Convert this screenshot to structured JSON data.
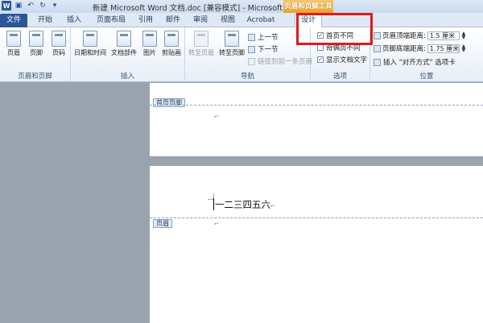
{
  "title_bar": {
    "document_title": "新建 Microsoft Word 文档.doc [兼容模式] - Microsoft Word",
    "context_tools": "页眉和页脚工具"
  },
  "tabs": {
    "file": "文件",
    "home": "开始",
    "insert": "插入",
    "layout": "页面布局",
    "references": "引用",
    "mailings": "邮件",
    "review": "审阅",
    "view": "视图",
    "acrobat": "Acrobat",
    "design": "设计"
  },
  "ribbon": {
    "group_header_footer": {
      "label": "页眉和页脚",
      "header": "页眉",
      "footer": "页脚",
      "page_number": "页码"
    },
    "group_insert": {
      "label": "插入",
      "date_time": "日期和时间",
      "doc_parts": "文档部件",
      "picture": "图片",
      "clip_art": "剪贴画"
    },
    "group_navigation": {
      "label": "导航",
      "goto_header": "转至页眉",
      "goto_footer": "转至页脚",
      "previous": "上一节",
      "next": "下一节",
      "link_previous": "链接到前一条页眉"
    },
    "group_options": {
      "label": "选项",
      "different_first_page": "首页不同",
      "different_odd_even": "奇偶页不同",
      "show_document_text": "显示文档文字",
      "different_first_page_checked": true,
      "different_odd_even_checked": false,
      "show_document_text_checked": true
    },
    "group_position": {
      "label": "位置",
      "header_from_top_label": "页眉顶端距离:",
      "header_from_top_value": "1.5 厘米",
      "footer_from_bottom_label": "页脚底端距离:",
      "footer_from_bottom_value": "1.75 厘米",
      "insert_alignment_tab": "插入 \"对齐方式\" 选项卡"
    }
  },
  "document": {
    "first_page_footer_tag": "首页页脚",
    "header_tag": "页眉",
    "body_text": "一二三四五六",
    "paragraph_mark": "↵"
  },
  "colors": {
    "highlight_border": "#e0191c",
    "file_tab": "#2b5797",
    "context_tools": "#e9a32c"
  }
}
